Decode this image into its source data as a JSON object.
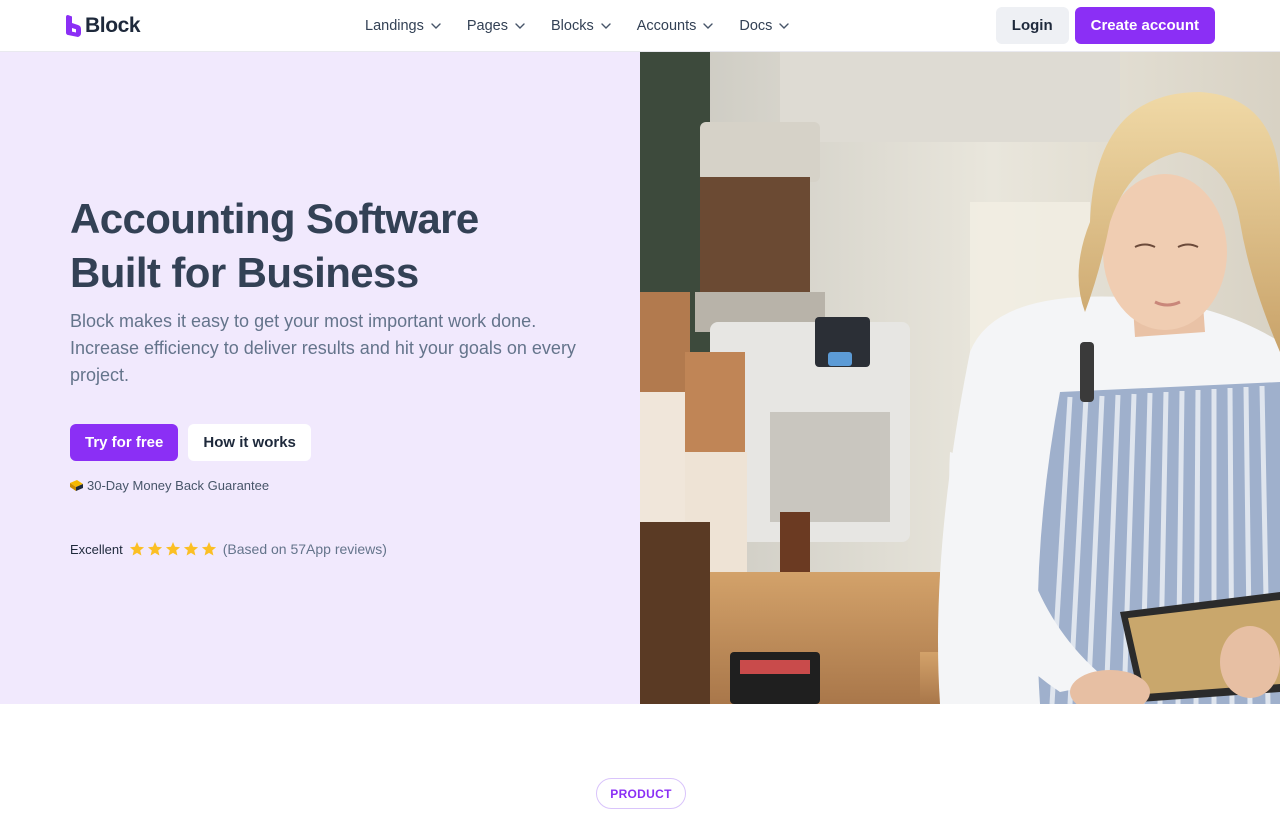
{
  "brand": {
    "name": "Block",
    "logo_icon": "block-logo-icon",
    "accent": "#8b2ff5"
  },
  "nav": {
    "items": [
      {
        "label": "Landings"
      },
      {
        "label": "Pages"
      },
      {
        "label": "Blocks"
      },
      {
        "label": "Accounts"
      },
      {
        "label": "Docs"
      }
    ],
    "login_label": "Login",
    "create_label": "Create account"
  },
  "hero": {
    "title_line1": "Accounting Software",
    "title_line2": "Built for Business",
    "description": "Block makes it easy to get your most important work done. Increase efficiency to deliver results and hit your goals on every project.",
    "primary_cta": "Try for free",
    "secondary_cta": "How it works",
    "guarantee_icon": "gold-bar-icon",
    "guarantee": "30-Day Money Back Guarantee",
    "rating_label": "Excellent",
    "rating_stars": 5,
    "rating_note": "(Based on 57App reviews)",
    "background": "#f1e9fd",
    "image_icon": "barista-tablet-photo"
  },
  "section": {
    "badge": "PRODUCT"
  }
}
